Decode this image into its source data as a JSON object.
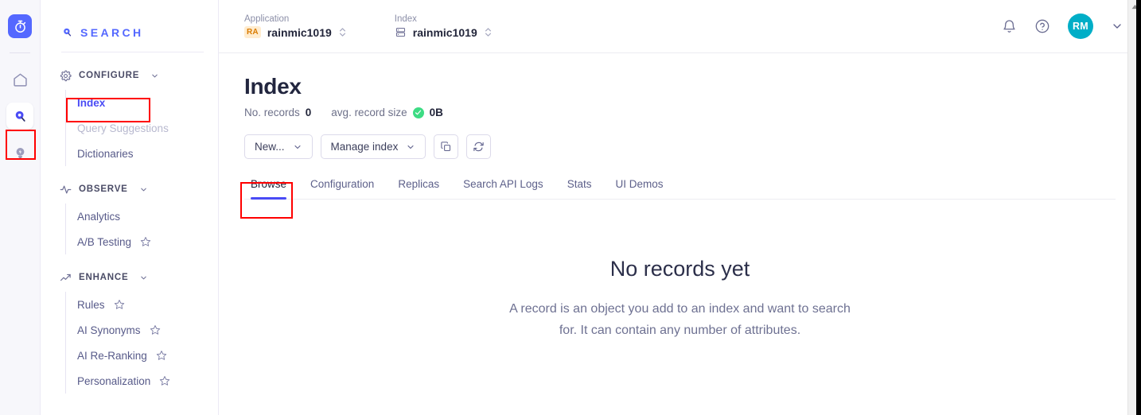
{
  "rail": {
    "logo_name": "algolia-logo",
    "items": [
      {
        "name": "home-icon",
        "active": false
      },
      {
        "name": "search-icon",
        "active": true
      },
      {
        "name": "lightbulb-icon",
        "active": false
      }
    ]
  },
  "sidebar": {
    "brand": "SEARCH",
    "groups": [
      {
        "label": "CONFIGURE",
        "icon": "gear-icon",
        "items": [
          {
            "label": "Index",
            "state": "active",
            "star": false
          },
          {
            "label": "Query Suggestions",
            "state": "muted",
            "star": false
          },
          {
            "label": "Dictionaries",
            "state": "normal",
            "star": false
          }
        ]
      },
      {
        "label": "OBSERVE",
        "icon": "activity-pulse-icon",
        "items": [
          {
            "label": "Analytics",
            "state": "normal",
            "star": false
          },
          {
            "label": "A/B Testing",
            "state": "normal",
            "star": true
          }
        ]
      },
      {
        "label": "ENHANCE",
        "icon": "trending-up-icon",
        "items": [
          {
            "label": "Rules",
            "state": "normal",
            "star": true
          },
          {
            "label": "AI Synonyms",
            "state": "normal",
            "star": true
          },
          {
            "label": "AI Re-Ranking",
            "state": "normal",
            "star": true
          },
          {
            "label": "Personalization",
            "state": "normal",
            "star": true
          }
        ]
      }
    ]
  },
  "topbar": {
    "application": {
      "label": "Application",
      "badge": "RA",
      "value": "rainmic1019"
    },
    "index": {
      "label": "Index",
      "value": "rainmic1019"
    },
    "notifications_icon": "bell-icon",
    "help_icon": "question-circle-icon",
    "avatar_initials": "RM",
    "avatar_color": "#00aec7",
    "account_chevron_icon": "chevron-down-icon"
  },
  "page": {
    "title": "Index",
    "stats": {
      "records_label": "No. records",
      "records_value": "0",
      "size_label": "avg. record size",
      "size_value": "0B",
      "size_status_icon": "check-circle-icon"
    },
    "buttons": {
      "new": "New...",
      "manage_index": "Manage index",
      "copy_icon": "copy-icon",
      "refresh_icon": "refresh-icon"
    },
    "tabs": [
      {
        "label": "Browse",
        "active": true
      },
      {
        "label": "Configuration",
        "active": false
      },
      {
        "label": "Replicas",
        "active": false
      },
      {
        "label": "Search API Logs",
        "active": false
      },
      {
        "label": "Stats",
        "active": false
      },
      {
        "label": "UI Demos",
        "active": false
      }
    ],
    "empty_state": {
      "title": "No records yet",
      "description": "A record is an object you add to an index and want to search for. It can contain any number of attributes."
    }
  },
  "annotations": {
    "highlight_color": "#ff0000",
    "highlighted_elements": [
      "sidebar-item-index",
      "rail-item-search",
      "tab-browse"
    ]
  },
  "scrollbar": {
    "up_arrow_icon": "scroll-up-arrow-icon"
  }
}
